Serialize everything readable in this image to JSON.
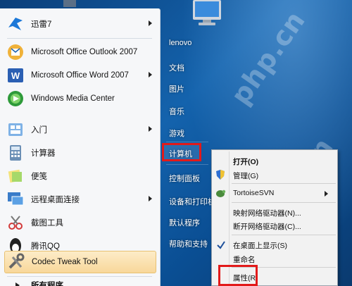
{
  "start_menu": {
    "programs": [
      {
        "label": "迅雷7",
        "icon": "thunder-icon",
        "submenu": true
      },
      {
        "label": "Microsoft Office Outlook 2007",
        "icon": "outlook-icon",
        "submenu": false
      },
      {
        "label": "Microsoft Office Word 2007",
        "icon": "word-icon",
        "submenu": true
      },
      {
        "label": "Windows Media Center",
        "icon": "media-center-icon",
        "submenu": false
      },
      {
        "label": "入门",
        "icon": "getting-started-icon",
        "submenu": true
      },
      {
        "label": "计算器",
        "icon": "calculator-icon",
        "submenu": false
      },
      {
        "label": "便笺",
        "icon": "sticky-notes-icon",
        "submenu": false
      },
      {
        "label": "远程桌面连接",
        "icon": "remote-desktop-icon",
        "submenu": true
      },
      {
        "label": "截图工具",
        "icon": "snipping-tool-icon",
        "submenu": false
      },
      {
        "label": "腾讯QQ",
        "icon": "qq-icon",
        "submenu": false
      },
      {
        "label": "Codec Tweak Tool",
        "icon": "codec-tool-icon",
        "submenu": false
      },
      {
        "label": "所有程序",
        "icon": "all-programs-arrow-icon",
        "submenu": false
      }
    ],
    "right_items": [
      "lenovo",
      "文档",
      "图片",
      "音乐",
      "游戏",
      "计算机",
      "控制面板",
      "设备和打印机",
      "默认程序",
      "帮助和支持"
    ]
  },
  "context_menu": {
    "items": [
      "打开(O)",
      "管理(G)",
      "TortoiseSVN",
      "映射网络驱动器(N)...",
      "断开网络驱动器(C)...",
      "在桌面上显示(S)",
      "重命名",
      "属性(R)"
    ]
  },
  "watermark": "php.cn",
  "colors": {
    "highlight_red": "#e21a1a",
    "hover": "#f8d79a"
  }
}
